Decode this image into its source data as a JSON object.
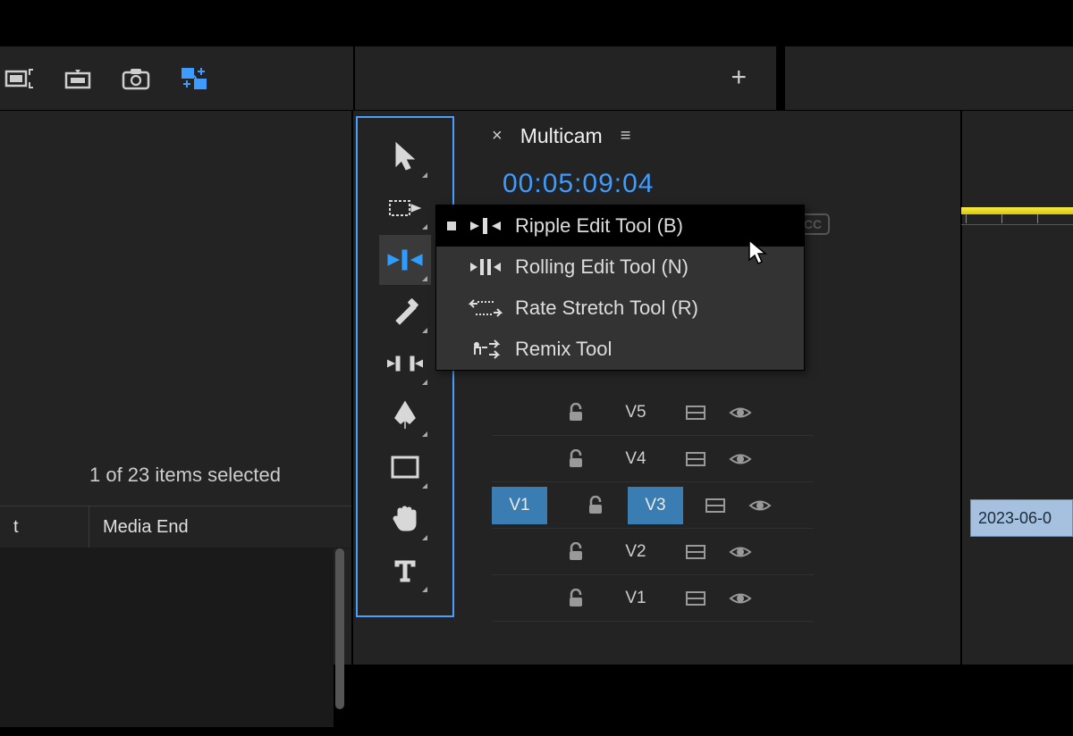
{
  "project_panel": {
    "selection_info": "1 of 23 items selected",
    "columns": {
      "col1": "t",
      "col2": "Media End"
    }
  },
  "toolbar_plus": "+",
  "sequence": {
    "close": "×",
    "name": "Multicam",
    "menu": "≡",
    "timecode": "00:05:09:04"
  },
  "flyout": {
    "items": [
      {
        "label": "Ripple Edit Tool (B)",
        "selected": true
      },
      {
        "label": "Rolling Edit Tool (N)",
        "selected": false
      },
      {
        "label": "Rate Stretch Tool (R)",
        "selected": false
      },
      {
        "label": "Remix Tool",
        "selected": false
      }
    ]
  },
  "tracks": [
    {
      "src": "",
      "label": "V5",
      "armed": false
    },
    {
      "src": "",
      "label": "V4",
      "armed": false
    },
    {
      "src": "V1",
      "label": "V3",
      "armed": true
    },
    {
      "src": "",
      "label": "V2",
      "armed": false
    },
    {
      "src": "",
      "label": "V1",
      "armed": false
    }
  ],
  "clip": {
    "name": "2023-06-0"
  },
  "cc": "CC"
}
